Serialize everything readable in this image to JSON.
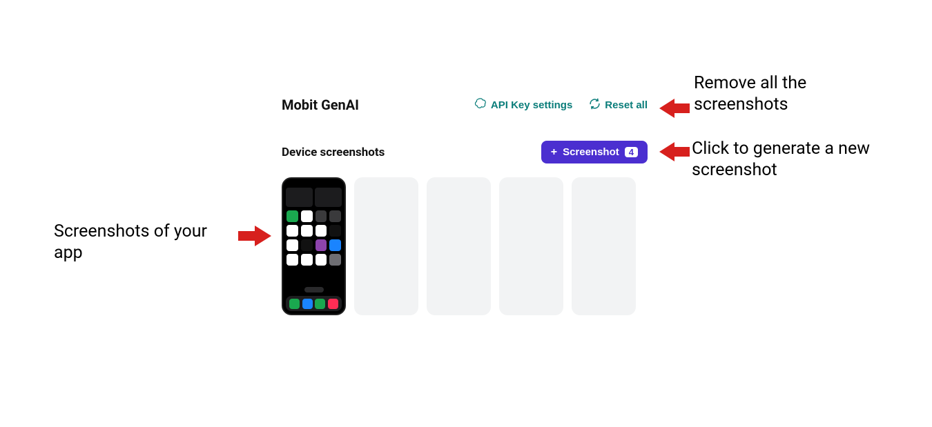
{
  "header": {
    "title": "Mobit GenAI",
    "api_key_label": "API Key settings",
    "reset_label": "Reset all"
  },
  "section": {
    "label": "Device screenshots",
    "screenshot_button_label": "Screenshot",
    "screenshot_badge": "4"
  },
  "annotations": {
    "left": "Screenshots of your app",
    "top_right": "Remove all the screenshots",
    "bottom_right": "Click to generate a new screenshot"
  },
  "icons": {
    "openai": "openai-icon",
    "reset": "reset-icon",
    "plus": "plus-icon"
  },
  "colors": {
    "accent_teal": "#0a7d7a",
    "accent_purple": "#4b2fd0",
    "arrow_red": "#d7201d"
  },
  "phone_app_colors": [
    "#1aa84f",
    "#ffffff",
    "#3a3a3c",
    "#3a3a3c",
    "#ffffff",
    "#ffffff",
    "#ffffff",
    "#111111",
    "#ffffff",
    "#111111",
    "#8e44ad",
    "#1a84ff",
    "#ffffff",
    "#ffffff",
    "#ffffff",
    "#6e6e73"
  ],
  "phone_dock_colors": [
    "#1aa84f",
    "#1a84ff",
    "#1aa84f",
    "#ff2d55"
  ]
}
